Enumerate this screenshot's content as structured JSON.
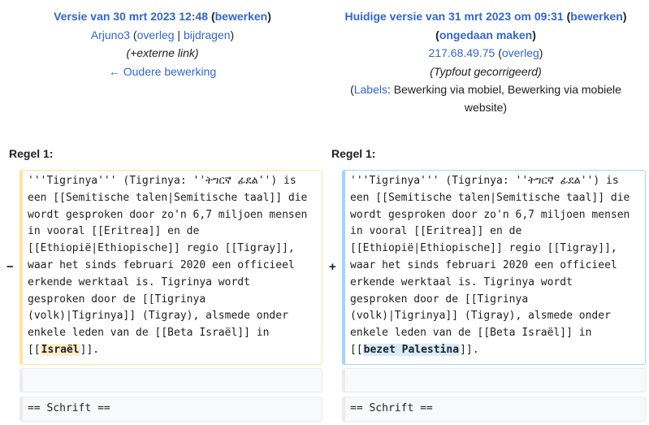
{
  "left_header": {
    "title_prefix": "Versie van 30 mrt 2023 12:48",
    "edit_link": "bewerken",
    "user": "Arjuno3",
    "talk_link": "overleg",
    "contribs_link": "bijdragen",
    "summary": "(+externe link)",
    "older_edit": "← Oudere bewerking"
  },
  "right_header": {
    "title_prefix": "Huidige versie van 31 mrt 2023 om 09:31",
    "edit_link": "bewerken",
    "undo_link": "ongedaan maken",
    "user": "217.68.49.75",
    "talk_link": "overleg",
    "summary": "(Typfout gecorrigeerd)",
    "labels_link": "Labels",
    "labels_text": ": Bewerking via mobiel, Bewerking via mobiele website)"
  },
  "diff": {
    "left_line_label": "Regel 1:",
    "right_line_label": "Regel 1:",
    "minus": "−",
    "plus": "+",
    "left_lines": [
      "'''Tigrinya''' (Tigrinya: ''ትግርኛ ፊደል'') is",
      "een [[Semitische talen|Semitische taal]] die",
      "wordt gesproken door zo'n 6,7 miljoen mensen",
      "in vooral [[Eritrea]] en de",
      "[[Ethiopië|Ethiopische]] regio [[Tigray]],",
      "waar het sinds februari 2020 een officieel",
      "erkende werktaal is. Tigrinya wordt",
      "gesproken door de [[Tigrinya",
      "(volk)|Tigrinya]] (Tigray), alsmede onder",
      "enkele leden van de [[Beta Israël]] in"
    ],
    "left_last_prefix": "[[",
    "left_changed": "Israël",
    "left_last_suffix": "]].",
    "right_lines": [
      "'''Tigrinya''' (Tigrinya: ''ትግርኛ ፊደል'') is",
      "een [[Semitische talen|Semitische taal]] die",
      "wordt gesproken door zo'n 6,7 miljoen mensen",
      "in vooral [[Eritrea]] en de",
      "[[Ethiopië|Ethiopische]] regio [[Tigray]],",
      "waar het sinds februari 2020 een officieel",
      "erkende werktaal is. Tigrinya wordt",
      "gesproken door de [[Tigrinya",
      "(volk)|Tigrinya]] (Tigray), alsmede onder",
      "enkele leden van de [[Beta Israël]] in"
    ],
    "right_last_prefix": "[[",
    "right_changed": "bezet Palestina",
    "right_last_suffix": "]].",
    "context_line": "== Schrift =="
  },
  "colors": {
    "link": "#3366cc",
    "deleted_border": "#ffe49c",
    "added_border": "#a3d3ff",
    "deleted_highlight": "#feeec8",
    "added_highlight": "#d8ecff"
  }
}
